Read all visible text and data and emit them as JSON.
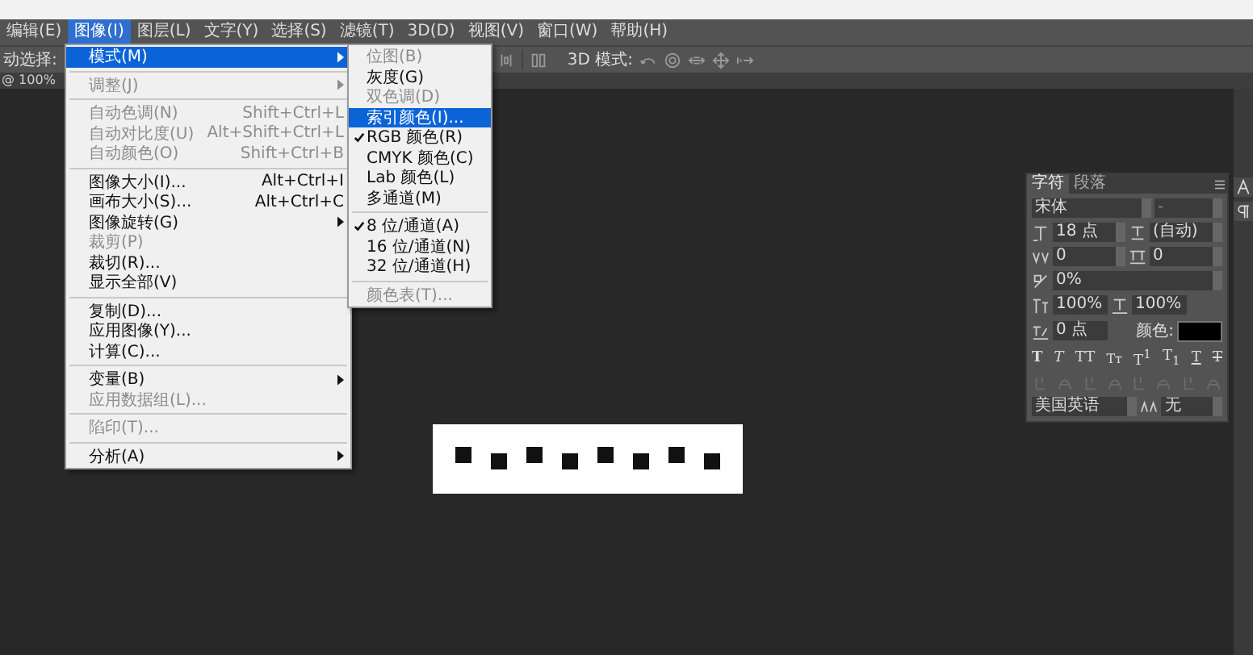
{
  "menu_bar": [
    {
      "label": "编辑(E)",
      "selected": false
    },
    {
      "label": "图像(I)",
      "selected": true
    },
    {
      "label": "图层(L)",
      "selected": false
    },
    {
      "label": "文字(Y)",
      "selected": false
    },
    {
      "label": "选择(S)",
      "selected": false
    },
    {
      "label": "滤镜(T)",
      "selected": false
    },
    {
      "label": "3D(D)",
      "selected": false
    },
    {
      "label": "视图(V)",
      "selected": false
    },
    {
      "label": "窗口(W)",
      "selected": false
    },
    {
      "label": "帮助(H)",
      "selected": false
    }
  ],
  "options_bar": {
    "tool_label": "动选择:",
    "mode_label": "3D 模式:"
  },
  "document_tab": {
    "label": "@ 100%"
  },
  "image_menu": [
    {
      "kind": "item",
      "label": "模式(M)",
      "submenu": true,
      "disabled": false,
      "selected": true
    },
    {
      "kind": "separator"
    },
    {
      "kind": "item",
      "label": "调整(J)",
      "submenu": true,
      "disabled": true,
      "selected": false
    },
    {
      "kind": "separator"
    },
    {
      "kind": "item",
      "label": "自动色调(N)",
      "shortcut": "Shift+Ctrl+L",
      "submenu": false,
      "disabled": true,
      "selected": false
    },
    {
      "kind": "item",
      "label": "自动对比度(U)",
      "shortcut": "Alt+Shift+Ctrl+L",
      "submenu": false,
      "disabled": true,
      "selected": false
    },
    {
      "kind": "item",
      "label": "自动颜色(O)",
      "shortcut": "Shift+Ctrl+B",
      "submenu": false,
      "disabled": true,
      "selected": false
    },
    {
      "kind": "separator"
    },
    {
      "kind": "item",
      "label": "图像大小(I)...",
      "shortcut": "Alt+Ctrl+I",
      "submenu": false,
      "disabled": false,
      "selected": false
    },
    {
      "kind": "item",
      "label": "画布大小(S)...",
      "shortcut": "Alt+Ctrl+C",
      "submenu": false,
      "disabled": false,
      "selected": false
    },
    {
      "kind": "item",
      "label": "图像旋转(G)",
      "submenu": true,
      "disabled": false,
      "selected": false
    },
    {
      "kind": "item",
      "label": "裁剪(P)",
      "submenu": false,
      "disabled": true,
      "selected": false
    },
    {
      "kind": "item",
      "label": "裁切(R)...",
      "submenu": false,
      "disabled": false,
      "selected": false
    },
    {
      "kind": "item",
      "label": "显示全部(V)",
      "submenu": false,
      "disabled": false,
      "selected": false
    },
    {
      "kind": "separator"
    },
    {
      "kind": "item",
      "label": "复制(D)...",
      "submenu": false,
      "disabled": false,
      "selected": false
    },
    {
      "kind": "item",
      "label": "应用图像(Y)...",
      "submenu": false,
      "disabled": false,
      "selected": false
    },
    {
      "kind": "item",
      "label": "计算(C)...",
      "submenu": false,
      "disabled": false,
      "selected": false
    },
    {
      "kind": "separator"
    },
    {
      "kind": "item",
      "label": "变量(B)",
      "submenu": true,
      "disabled": false,
      "selected": false
    },
    {
      "kind": "item",
      "label": "应用数据组(L)...",
      "submenu": false,
      "disabled": true,
      "selected": false
    },
    {
      "kind": "separator"
    },
    {
      "kind": "item",
      "label": "陷印(T)...",
      "submenu": false,
      "disabled": true,
      "selected": false
    },
    {
      "kind": "separator"
    },
    {
      "kind": "item",
      "label": "分析(A)",
      "submenu": true,
      "disabled": false,
      "selected": false
    }
  ],
  "mode_submenu": [
    {
      "kind": "item",
      "label": "位图(B)",
      "checked": false,
      "disabled": true,
      "selected": false
    },
    {
      "kind": "item",
      "label": "灰度(G)",
      "checked": false,
      "disabled": false,
      "selected": false
    },
    {
      "kind": "item",
      "label": "双色调(D)",
      "checked": false,
      "disabled": true,
      "selected": false
    },
    {
      "kind": "item",
      "label": "索引颜色(I)...",
      "checked": false,
      "disabled": false,
      "selected": true
    },
    {
      "kind": "item",
      "label": "RGB 颜色(R)",
      "checked": true,
      "disabled": false,
      "selected": false
    },
    {
      "kind": "item",
      "label": "CMYK 颜色(C)",
      "checked": false,
      "disabled": false,
      "selected": false
    },
    {
      "kind": "item",
      "label": "Lab 颜色(L)",
      "checked": false,
      "disabled": false,
      "selected": false
    },
    {
      "kind": "item",
      "label": "多通道(M)",
      "checked": false,
      "disabled": false,
      "selected": false
    },
    {
      "kind": "separator"
    },
    {
      "kind": "item",
      "label": "8 位/通道(A)",
      "checked": true,
      "disabled": false,
      "selected": false
    },
    {
      "kind": "item",
      "label": "16 位/通道(N)",
      "checked": false,
      "disabled": false,
      "selected": false
    },
    {
      "kind": "item",
      "label": "32 位/通道(H)",
      "checked": false,
      "disabled": false,
      "selected": false
    },
    {
      "kind": "separator"
    },
    {
      "kind": "item",
      "label": "颜色表(T)...",
      "checked": false,
      "disabled": true,
      "selected": false
    }
  ],
  "character_panel": {
    "tabs": [
      {
        "label": "字符",
        "selected": true
      },
      {
        "label": "段落",
        "selected": false
      }
    ],
    "font_family": "宋体",
    "font_style": "-",
    "font_size": "18 点",
    "leading": "(自动)",
    "kerning": "0",
    "tracking": "0",
    "tsume": "0%",
    "vertical_scale": "100%",
    "horizontal_scale": "100%",
    "baseline_shift": "0 点",
    "color_label": "颜色:",
    "style_buttons": [
      {
        "label": "T",
        "kind": "bold"
      },
      {
        "label": "T",
        "kind": "italic"
      },
      {
        "label": "TT",
        "kind": "caps"
      },
      {
        "label": "Tт",
        "kind": "smallcaps"
      },
      {
        "label": "T$^{1}$",
        "kind": "superscript"
      },
      {
        "label": "T$_{1}$",
        "kind": "subscript"
      },
      {
        "label": "T",
        "kind": "underline"
      },
      {
        "label": "T",
        "kind": "strikethrough"
      }
    ],
    "language": "美国英语",
    "antialias": "无"
  }
}
